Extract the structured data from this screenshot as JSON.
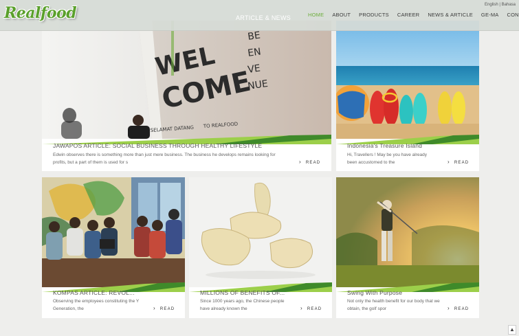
{
  "header": {
    "logo": "Realfood",
    "section_title": "ARTICLE & NEWS",
    "lang": {
      "en": "English",
      "sep": "|",
      "id": "Bahasa"
    },
    "nav": [
      "HOME",
      "ABOUT",
      "PRODUCTS",
      "CAREER",
      "NEWS & ARTICLE",
      "GE-MA",
      "CONTACT"
    ],
    "active_nav": "HOME"
  },
  "images": {
    "welcome_wall": [
      "WEL",
      "COME",
      "BE",
      "EN",
      "VE",
      "NUE",
      "SELAMAT DATANG",
      "TO REALFOOD"
    ]
  },
  "cards": [
    {
      "title": "JAWAPOS ARTICLE: SOCIAL BUSINESS THROUGH HEALTHY LIFESTYLE",
      "excerpt": "Edwin observes there is something more than just mere business. The business he develops remains looking for profits, but a part of them is used for s",
      "read": "READ"
    },
    {
      "title": "Indonesia's Treasure Island",
      "excerpt": "Hi, Travellers ! May be you have already been accustomed to the",
      "read": "READ"
    },
    {
      "title": "KOMPAS ARTICLE: REVOL...",
      "excerpt": "Observing the employees constituting the Y Generation, the",
      "read": "READ"
    },
    {
      "title": "MILLIONS OF BENEFITS OF...",
      "excerpt": "Since 1000 years ago, the Chinese people have already known the",
      "read": "READ"
    },
    {
      "title": "Swing With Purpose",
      "excerpt": "Not only the health benefit for our body that we obtain, the golf spor",
      "read": "READ"
    }
  ],
  "colors": {
    "accent": "#6cae3b",
    "swoosh_dark": "#3f8a2a",
    "swoosh_light": "#9ccf4a"
  }
}
